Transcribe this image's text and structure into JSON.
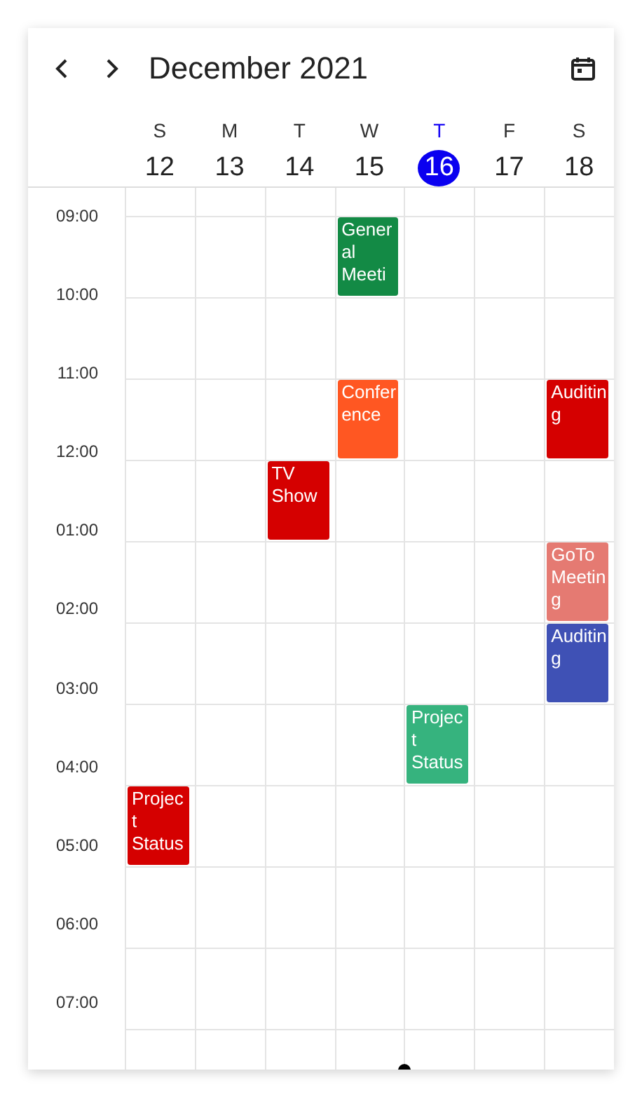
{
  "header": {
    "title": "December 2021"
  },
  "days": [
    {
      "weekday": "S",
      "date": "12",
      "selected": false
    },
    {
      "weekday": "M",
      "date": "13",
      "selected": false
    },
    {
      "weekday": "T",
      "date": "14",
      "selected": false
    },
    {
      "weekday": "W",
      "date": "15",
      "selected": false
    },
    {
      "weekday": "T",
      "date": "16",
      "selected": true
    },
    {
      "weekday": "F",
      "date": "17",
      "selected": false
    },
    {
      "weekday": "S",
      "date": "18",
      "selected": false
    }
  ],
  "rows": [
    {
      "time": "09:00",
      "cells": [
        null,
        null,
        null,
        {
          "title": "General Meeti",
          "color": "#138a45"
        },
        null,
        null,
        null
      ]
    },
    {
      "time": "10:00",
      "cells": [
        null,
        null,
        null,
        null,
        null,
        null,
        null
      ]
    },
    {
      "time": "11:00",
      "cells": [
        null,
        null,
        null,
        {
          "title": "Conference",
          "color": "#ff5722"
        },
        null,
        null,
        {
          "title": "Auditing",
          "color": "#d50000"
        }
      ]
    },
    {
      "time": "12:00",
      "cells": [
        null,
        null,
        {
          "title": "TV Show",
          "color": "#d50000"
        },
        null,
        null,
        null,
        null
      ]
    },
    {
      "time": "01:00",
      "cells": [
        null,
        null,
        null,
        null,
        null,
        null,
        {
          "title": "GoTo Meeting",
          "color": "#e57a72"
        }
      ]
    },
    {
      "time": "02:00",
      "cells": [
        null,
        null,
        null,
        null,
        null,
        null,
        {
          "title": "Auditing",
          "color": "#3f51b5"
        }
      ]
    },
    {
      "time": "03:00",
      "cells": [
        null,
        null,
        null,
        null,
        {
          "title": "Project Status",
          "color": "#36b37e"
        },
        null,
        null
      ]
    },
    {
      "time": "04:00",
      "cells": [
        {
          "title": "Project Status",
          "color": "#d50000"
        },
        null,
        null,
        null,
        null,
        null,
        null
      ]
    },
    {
      "time": "05:00",
      "cells": [
        null,
        null,
        null,
        null,
        null,
        null,
        null
      ]
    },
    {
      "time": "06:00",
      "cells": [
        null,
        null,
        null,
        null,
        null,
        null,
        null
      ]
    },
    {
      "time": "07:00",
      "cells": [
        null,
        null,
        null,
        null,
        null,
        null,
        null
      ]
    }
  ]
}
